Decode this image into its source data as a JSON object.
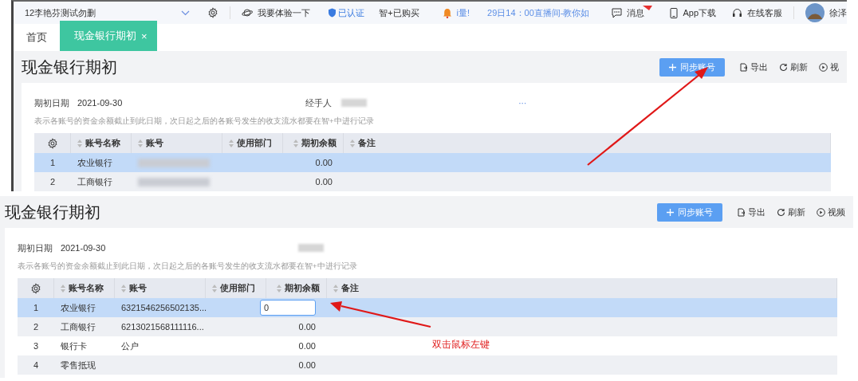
{
  "top_bar": {
    "company": "12李艳芬测试勿删",
    "try": "我要体验一下",
    "certified": "已认证",
    "purchased": "智+已购买",
    "notice": "i量!",
    "live": "29日14：00直播间-教你如",
    "messages": "消息",
    "app": "App下载",
    "service": "在线客服",
    "user": "徐泽"
  },
  "tabs": [
    {
      "label": "首页",
      "selected": false
    },
    {
      "label": "现金银行期初",
      "selected": true,
      "close": "×"
    }
  ],
  "panels": [
    {
      "title": "现金银行期初",
      "toolbar": [
        {
          "kind": "primary",
          "label": "同步账号"
        },
        {
          "kind": "link",
          "label": "导出"
        },
        {
          "kind": "link",
          "label": "刷新"
        },
        {
          "kind": "link",
          "label": "视"
        }
      ],
      "date_label": "期初日期",
      "date": "2021-09-30",
      "handler_label": "经手人",
      "handler_blurred": true,
      "more": "···",
      "note": "表示各账号的资金余额截止到此日期，次日起之后的各账号发生的收支流水都要在智+中进行记录",
      "columns": [
        {
          "kind": "settings"
        },
        {
          "kind": "sort",
          "label": "账号名称"
        },
        {
          "kind": "sort",
          "label": "账号"
        },
        {
          "kind": "sort",
          "label": "使用部门"
        },
        {
          "kind": "sort",
          "label": "期初余额"
        },
        {
          "kind": "sort",
          "label": "备注"
        }
      ],
      "rows": [
        {
          "no": "1",
          "name": "农业银行",
          "account_blurred": true,
          "balance": "0.00",
          "selected": true
        },
        {
          "no": "2",
          "name": "工商银行",
          "account_blurred": true,
          "balance": "0.00",
          "selected": false
        }
      ]
    },
    {
      "title": "现金银行期初",
      "toolbar": [
        {
          "kind": "primary",
          "label": "同步账号"
        },
        {
          "kind": "link",
          "label": "导出"
        },
        {
          "kind": "link",
          "label": "刷新"
        },
        {
          "kind": "link",
          "label": "视频"
        }
      ],
      "date_label": "期初日期",
      "date": "2021-09-30",
      "handler_blurred": true,
      "note": "表示各账号的资金余额截止到此日期，次日起之后的各账号发生的收支流水都要在智+中进行记录",
      "columns": [
        {
          "kind": "settings"
        },
        {
          "kind": "sort",
          "label": "账号名称"
        },
        {
          "kind": "sort",
          "label": "账号"
        },
        {
          "kind": "sort",
          "label": "使用部门"
        },
        {
          "kind": "sort",
          "label": "期初余额"
        },
        {
          "kind": "sort",
          "label": "备注"
        }
      ],
      "rows": [
        {
          "no": "1",
          "name": "农业银行",
          "account": "6321546256502135...",
          "balance_input": "0",
          "selected": true
        },
        {
          "no": "2",
          "name": "工商银行",
          "account": "6213021568111116...",
          "balance": "0.00",
          "selected": false
        },
        {
          "no": "3",
          "name": "银行卡",
          "account": "公户",
          "balance": "0.00",
          "selected": false
        },
        {
          "no": "4",
          "name": "零售抵现",
          "balance": "0.00",
          "selected": false
        }
      ]
    }
  ],
  "annotation": {
    "text": "双击鼠标左键"
  }
}
